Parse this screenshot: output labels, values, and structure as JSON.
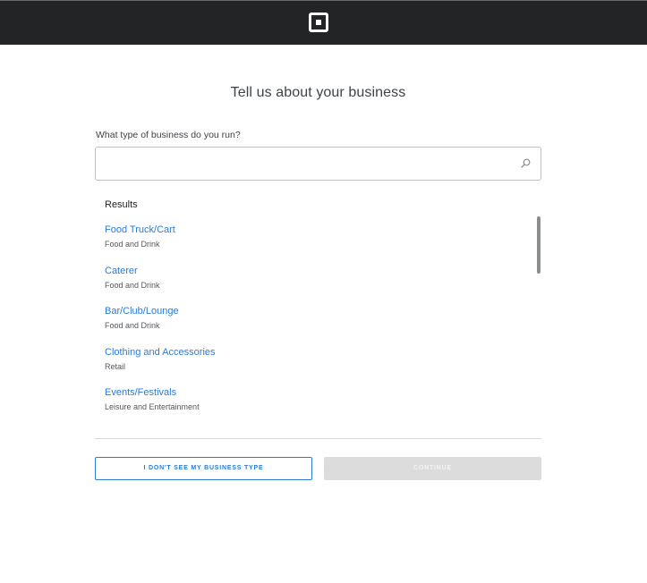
{
  "header": {
    "logo_icon": "square-logo-icon",
    "background": "#222426"
  },
  "page": {
    "title": "Tell us about your business"
  },
  "search": {
    "label": "What type of business do you run?",
    "value": "",
    "placeholder": "",
    "icon": "search-icon"
  },
  "results": {
    "heading": "Results",
    "items": [
      {
        "name": "Food Truck/Cart",
        "category": "Food and Drink"
      },
      {
        "name": "Caterer",
        "category": "Food and Drink"
      },
      {
        "name": "Bar/Club/Lounge",
        "category": "Food and Drink"
      },
      {
        "name": "Clothing and Accessories",
        "category": "Retail"
      },
      {
        "name": "Events/Festivals",
        "category": "Leisure and Entertainment"
      }
    ]
  },
  "actions": {
    "secondary_label": "I don't see my business type",
    "primary_label": "Continue",
    "primary_disabled": true
  },
  "colors": {
    "link": "#2b7bd6",
    "disabled": "#dcdcdc"
  }
}
